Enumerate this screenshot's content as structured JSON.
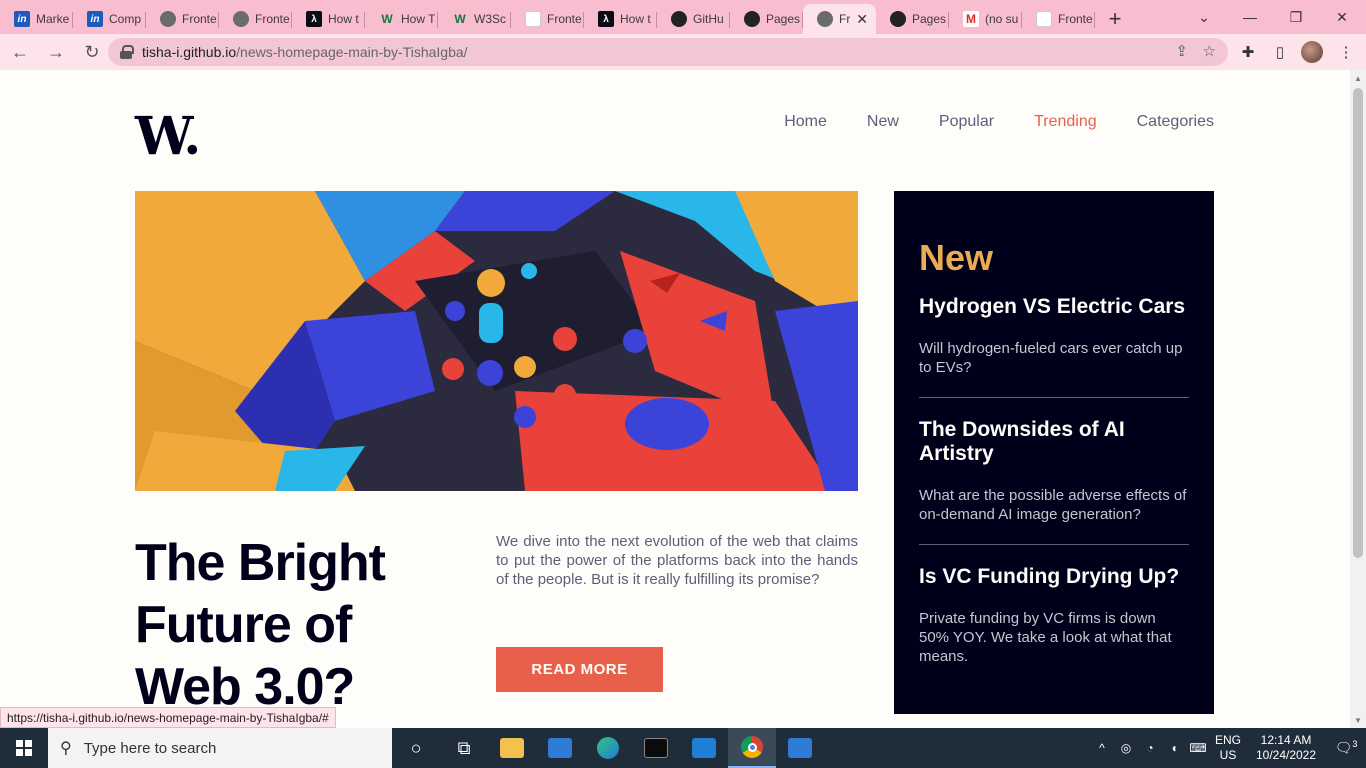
{
  "browser": {
    "tabs": [
      {
        "label": "Marke",
        "icon": "invision-icon",
        "fav": "inv",
        "glyph": "in"
      },
      {
        "label": "Comp",
        "icon": "invision-icon",
        "fav": "inv",
        "glyph": "in"
      },
      {
        "label": "Fronte",
        "icon": "globe-icon",
        "fav": "globe",
        "glyph": ""
      },
      {
        "label": "Fronte",
        "icon": "globe-icon",
        "fav": "globe",
        "glyph": ""
      },
      {
        "label": "How t",
        "icon": "dev-icon",
        "fav": "dev",
        "glyph": "λ"
      },
      {
        "label": "How T",
        "icon": "w3schools-icon",
        "fav": "w3",
        "glyph": "W"
      },
      {
        "label": "W3Sc",
        "icon": "w3schools-icon",
        "fav": "w3",
        "glyph": "W"
      },
      {
        "label": "Fronte",
        "icon": "frontendmentor-icon",
        "fav": "fm",
        "glyph": ""
      },
      {
        "label": "How t",
        "icon": "dev-icon",
        "fav": "dev",
        "glyph": "λ"
      },
      {
        "label": "GitHu",
        "icon": "github-icon",
        "fav": "gh",
        "glyph": ""
      },
      {
        "label": "Pages",
        "icon": "github-icon",
        "fav": "gh",
        "glyph": ""
      },
      {
        "label": "Fr",
        "icon": "globe-icon",
        "fav": "globe",
        "glyph": "",
        "active": true
      },
      {
        "label": "Pages",
        "icon": "github-icon",
        "fav": "gh",
        "glyph": ""
      },
      {
        "label": "(no su",
        "icon": "gmail-icon",
        "fav": "gm",
        "glyph": "M"
      },
      {
        "label": "Fronte",
        "icon": "frontendmentor-icon",
        "fav": "fm",
        "glyph": ""
      }
    ],
    "new_tab": "+",
    "tab_close": "✕",
    "url_domain": "tisha-i.github.io",
    "url_path": "/news-homepage-main-by-TishaIgba/",
    "status_url": "https://tisha-i.github.io/news-homepage-main-by-TishaIgba/#"
  },
  "site": {
    "logo": "W.",
    "nav": [
      {
        "label": "Home"
      },
      {
        "label": "New"
      },
      {
        "label": "Popular"
      },
      {
        "label": "Trending",
        "active": true
      },
      {
        "label": "Categories"
      }
    ],
    "headline": "The Bright Future of Web 3.0?",
    "lede": "We dive into the next evolution of the web that claims to put the power of the platforms back into the hands of the people. But is it really fulfilling its promise?",
    "cta": "READ MORE",
    "new_heading": "New",
    "new_items": [
      {
        "title": "Hydrogen VS Electric Cars",
        "text": "Will hydrogen-fueled cars ever catch up to EVs?"
      },
      {
        "title": "The Downsides of AI Artistry",
        "text": "What are the possible adverse effects of on-demand AI image generation?"
      },
      {
        "title": "Is VC Funding Drying Up?",
        "text": "Private funding by VC firms is down 50% YOY. We take a look at what that means."
      }
    ],
    "colors": {
      "accent": "#e9604a",
      "new_heading": "#e9ab53",
      "dark": "#00001a"
    }
  },
  "taskbar": {
    "search_placeholder": "Type here to search",
    "lang_1": "ENG",
    "lang_2": "US",
    "time": "12:14 AM",
    "date": "10/24/2022",
    "notifications": "3"
  }
}
